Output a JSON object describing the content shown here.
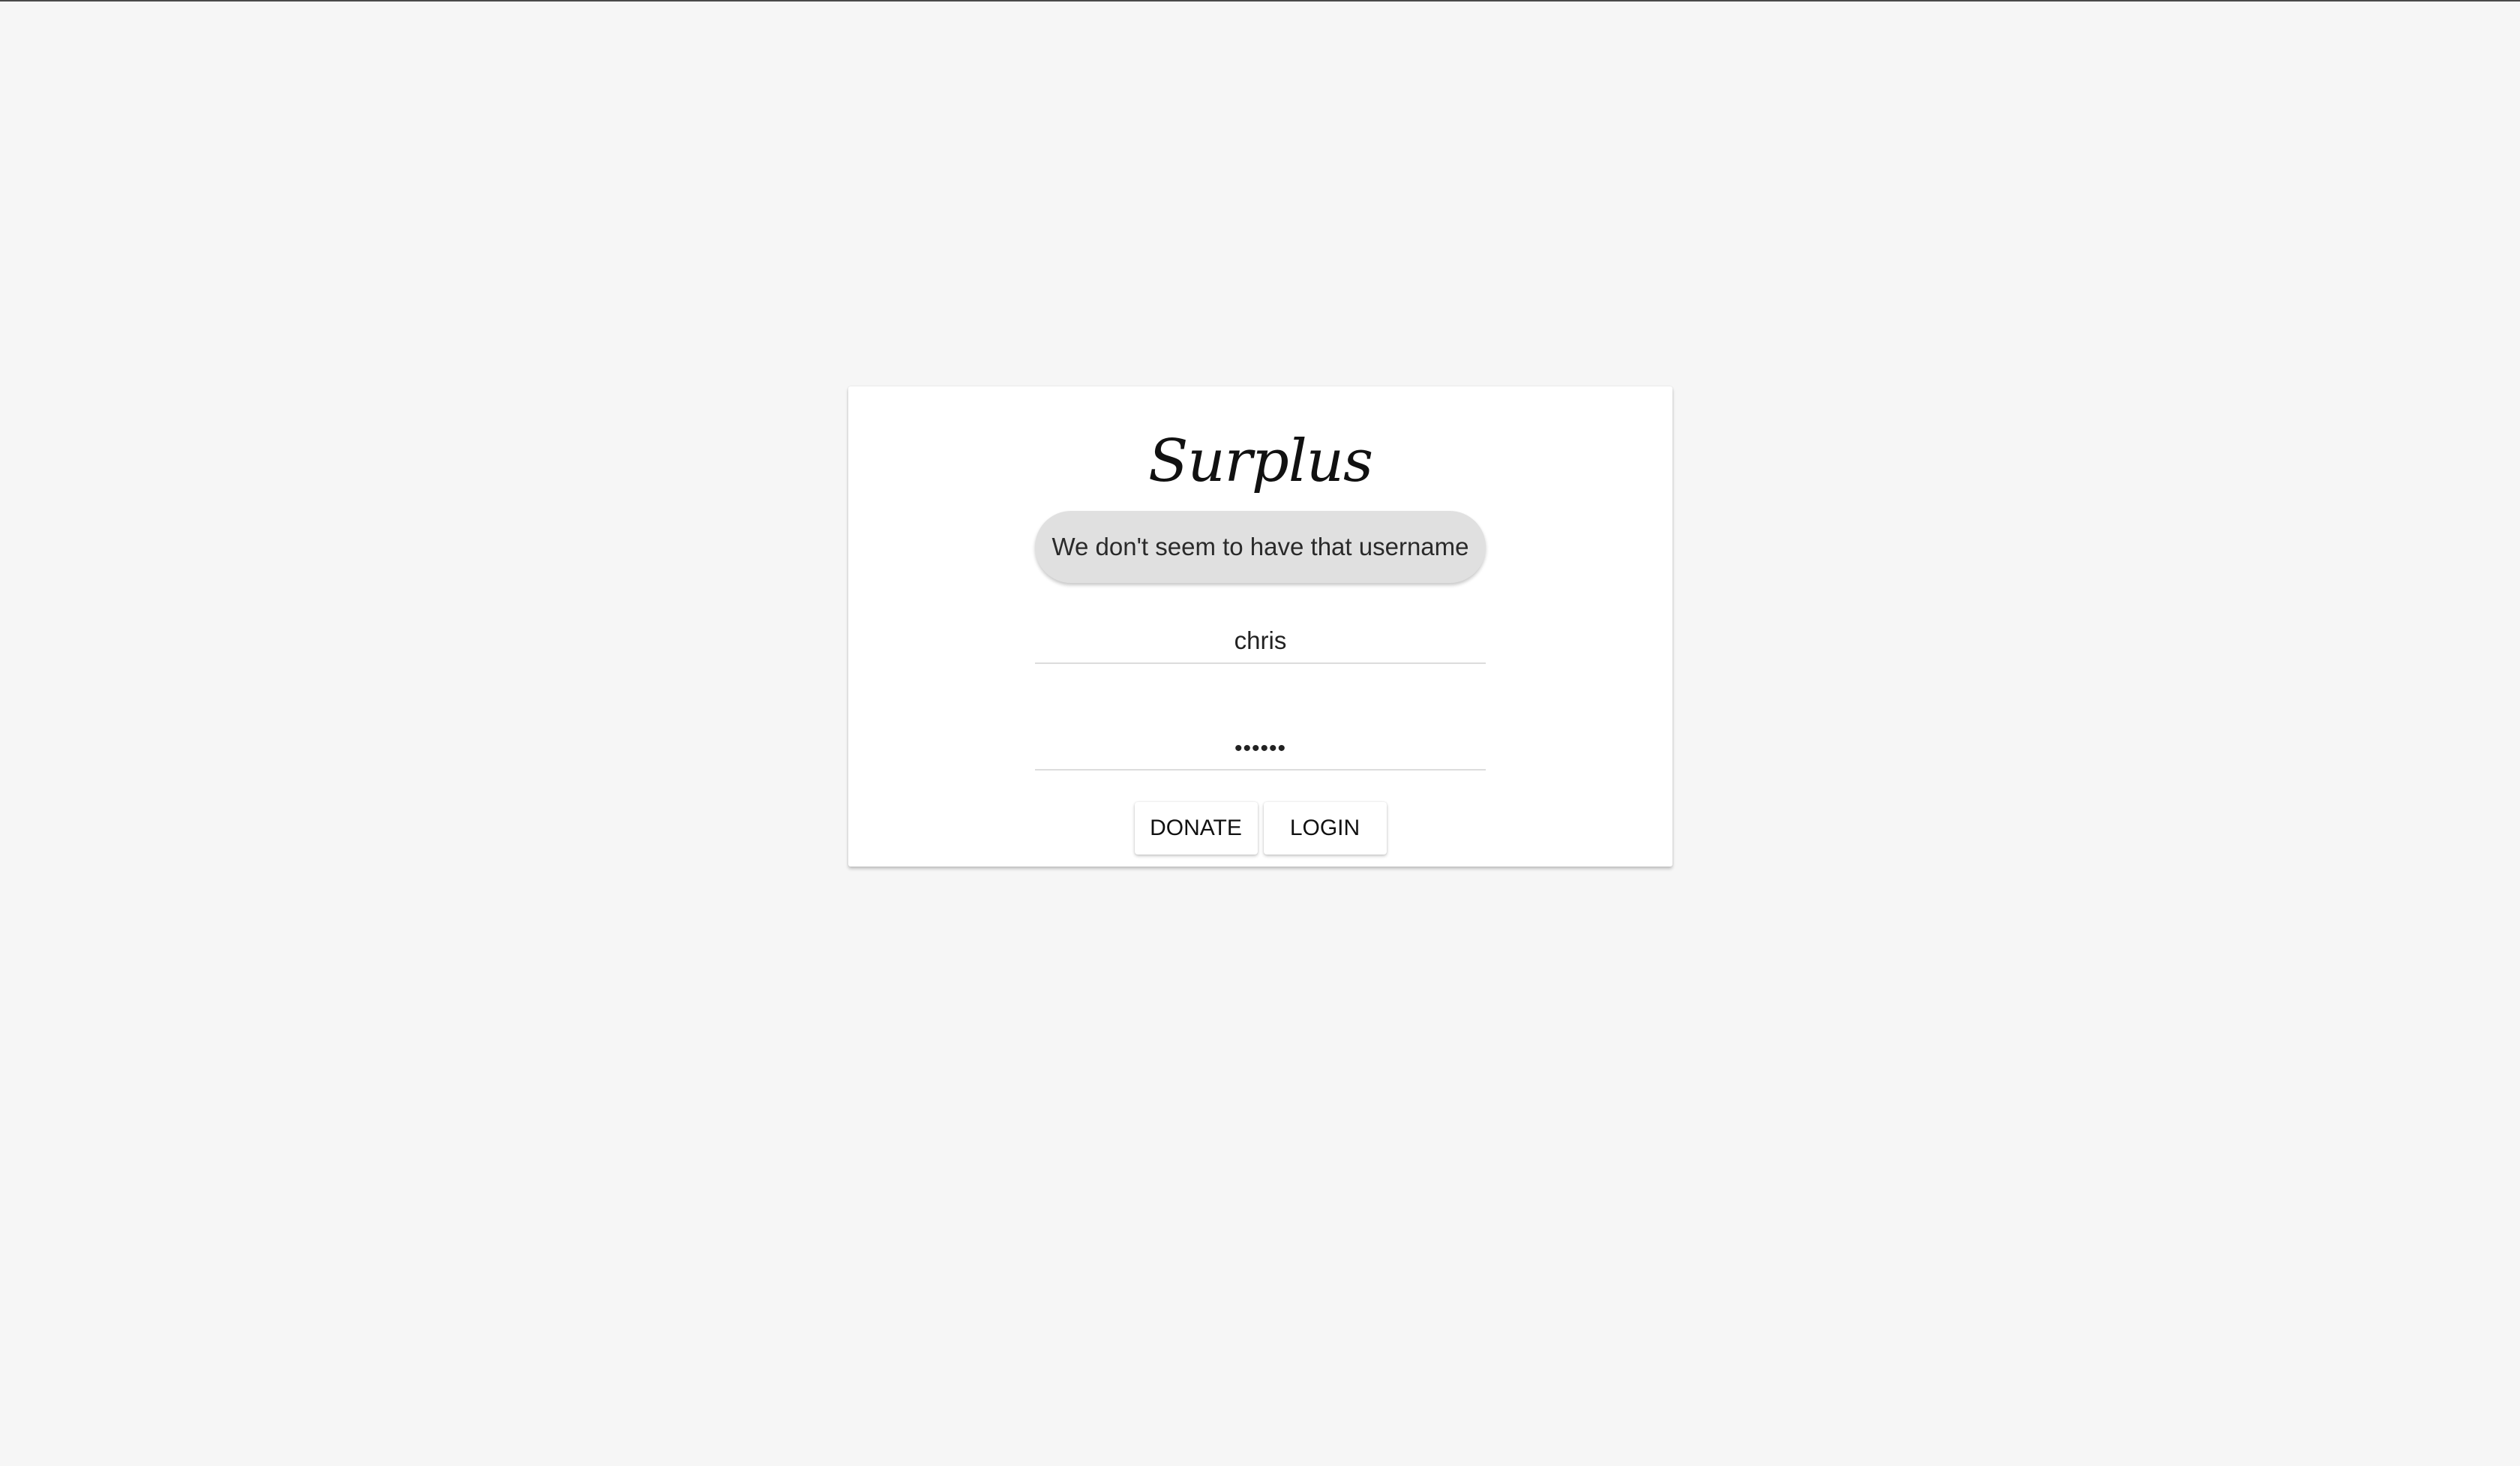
{
  "app": {
    "logo_text": "Surplus"
  },
  "alert": {
    "message": "We don't seem to have that username"
  },
  "form": {
    "username_value": "chris",
    "password_value": "••••••"
  },
  "actions": {
    "donate_label": "DONATE",
    "login_label": "LOGIN"
  },
  "colors": {
    "background": "#f6f6f6",
    "card": "#ffffff",
    "alert_background": "#e0e0e0",
    "text": "#222222"
  }
}
